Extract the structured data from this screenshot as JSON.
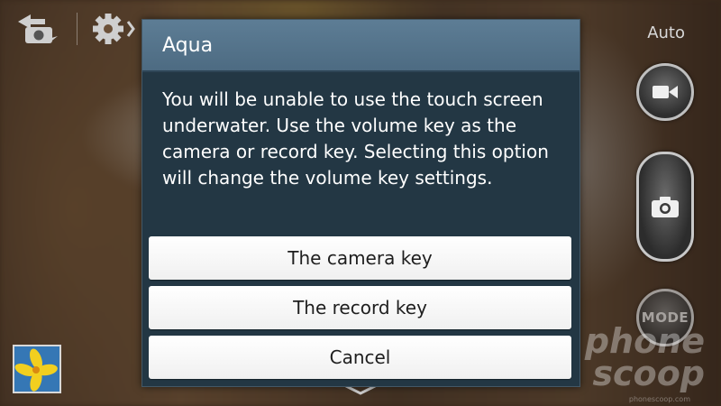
{
  "camera": {
    "flash_mode_label": "Auto",
    "mode_button_label": "MODE",
    "icons": [
      "switch-camera-icon",
      "settings-gear-icon",
      "video-camera-icon",
      "camera-icon",
      "gallery-thumbnail",
      "chevron-down-icon"
    ]
  },
  "dialog": {
    "title": "Aqua",
    "message": "You will be unable to use the touch screen underwater. Use the volume key as the camera or record key. Selecting this option will change the volume key settings.",
    "options": [
      {
        "label": "The camera key"
      },
      {
        "label": "The record key"
      },
      {
        "label": "Cancel"
      }
    ]
  },
  "watermark": {
    "line1": "phone",
    "line2": "scoop",
    "url": "phonescoop.com"
  },
  "colors": {
    "dialog_title_bg": "#4d6b82",
    "dialog_body_bg": "#233744",
    "button_bg": "#ffffff"
  }
}
